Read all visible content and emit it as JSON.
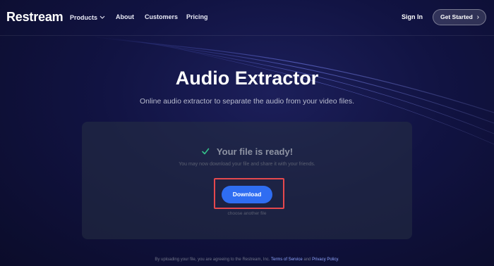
{
  "brand": {
    "logo": "Restream"
  },
  "nav": {
    "products": "Products",
    "about": "About",
    "customers": "Customers",
    "pricing": "Pricing",
    "sign_in": "Sign In",
    "get_started": "Get Started",
    "products_icon": "chevron-down-icon",
    "get_started_icon": "chevron-right-icon"
  },
  "hero": {
    "title": "Audio Extractor",
    "subtitle": "Online audio extractor to separate the audio from your video files."
  },
  "card": {
    "status_icon": "check-icon",
    "status_title": "Your file is ready!",
    "status_desc": "You may now download your file and share it with your friends.",
    "download_label": "Download",
    "choose_another": "choose another file"
  },
  "footer": {
    "legal_prefix": "By uploading your file, you are agreeing to the Restream, Inc.",
    "terms_link": "Terms of Service",
    "and": "and",
    "privacy_link": "Privacy Policy",
    "period": "."
  },
  "colors": {
    "background": "#0b0c2a",
    "accent_button": "#2f6df2",
    "check": "#35c28a",
    "highlight": "#e5484d",
    "link": "#8fa6ff"
  }
}
